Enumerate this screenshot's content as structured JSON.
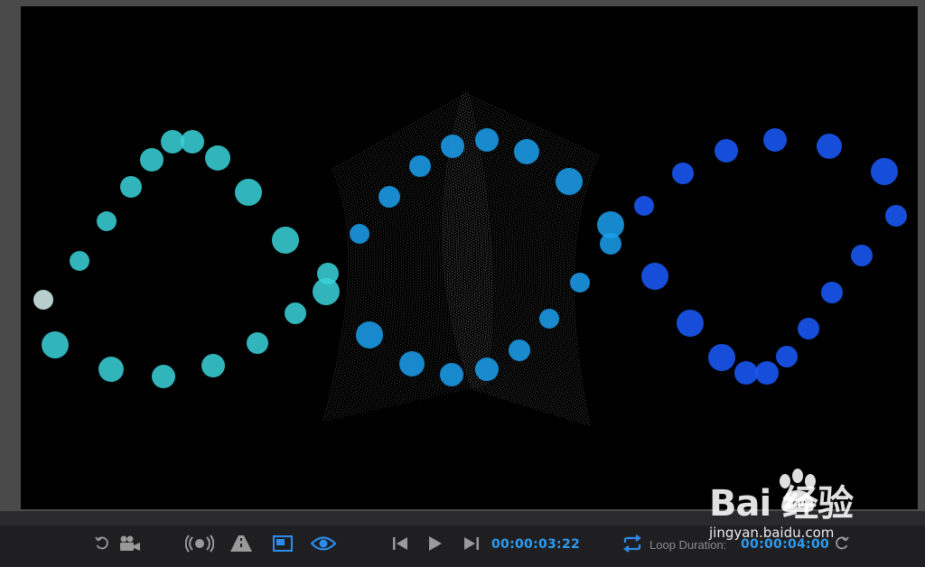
{
  "viewer": {
    "background_color": "#000000"
  },
  "particles": {
    "left_loop_color": "#3ad3da",
    "center_ring_color": "#1aa0ef",
    "right_loop_color": "#1a5cff",
    "mesh_color": "#d9d9d9"
  },
  "controls": {
    "accent_color": "#2d8ceb",
    "buttons": [
      {
        "name": "reset-camera-button",
        "icon": "rotate-ccw-icon"
      },
      {
        "name": "camera-button",
        "icon": "video-camera-icon"
      },
      {
        "name": "broadcast-button",
        "icon": "broadcast-icon"
      },
      {
        "name": "perspective-button",
        "icon": "road-icon"
      },
      {
        "name": "safe-area-button",
        "icon": "frame-icon",
        "active": true
      },
      {
        "name": "visibility-button",
        "icon": "eye-icon",
        "active": true
      },
      {
        "name": "go-to-start-button",
        "icon": "skip-back-icon"
      },
      {
        "name": "play-button",
        "icon": "play-icon"
      },
      {
        "name": "go-to-end-button",
        "icon": "skip-forward-icon"
      },
      {
        "name": "loop-button",
        "icon": "loop-icon",
        "active": true
      },
      {
        "name": "reset-loop-button",
        "icon": "rotate-cw-icon"
      }
    ],
    "current_time": "00:00:03:22",
    "loop_duration_label": "Loop Duration:",
    "loop_duration_value": "00:00:04:00"
  },
  "watermark": {
    "logo_text": "Bai  经验",
    "sub_text": "jingyan.baidu.com"
  }
}
